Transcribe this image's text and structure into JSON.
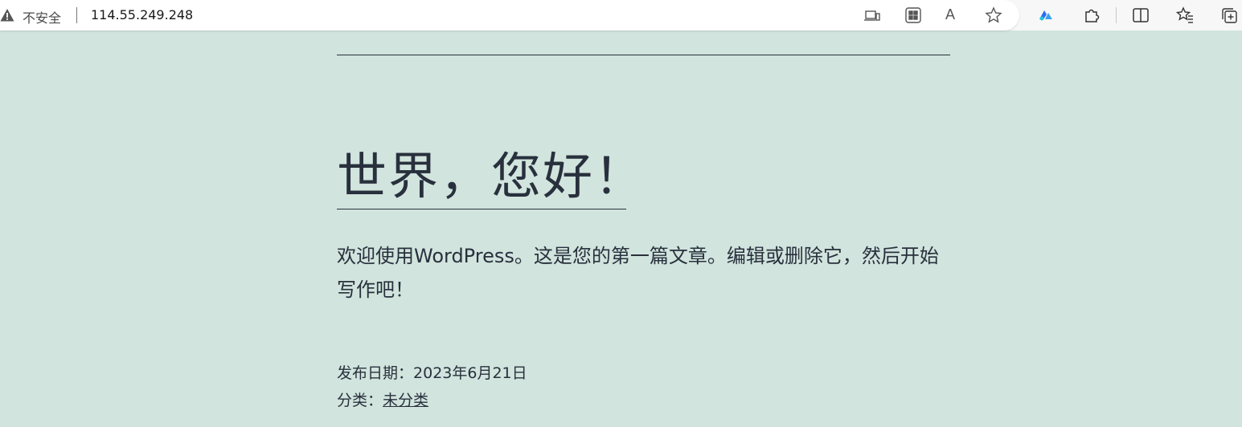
{
  "browser": {
    "security_label": "不安全",
    "url": "114.55.249.248",
    "read_aloud_glyph": "A",
    "icons": [
      "warning-icon",
      "app-available-icon",
      "apps-icon",
      "read-aloud-icon",
      "favorite-star-icon",
      "extension-logo-icon",
      "extensions-puzzle-icon",
      "split-screen-icon",
      "favorites-icon",
      "collections-icon"
    ]
  },
  "post": {
    "title": "世界，您好！",
    "body": "欢迎使用WordPress。这是您的第一篇文章。编辑或删除它，然后开始写作吧！",
    "date_label": "发布日期：",
    "date_value": "2023年6月21日",
    "category_label": "分类：",
    "category_value": "未分类"
  },
  "colors": {
    "page_background": "#d1e4dd",
    "text": "#28303d"
  }
}
